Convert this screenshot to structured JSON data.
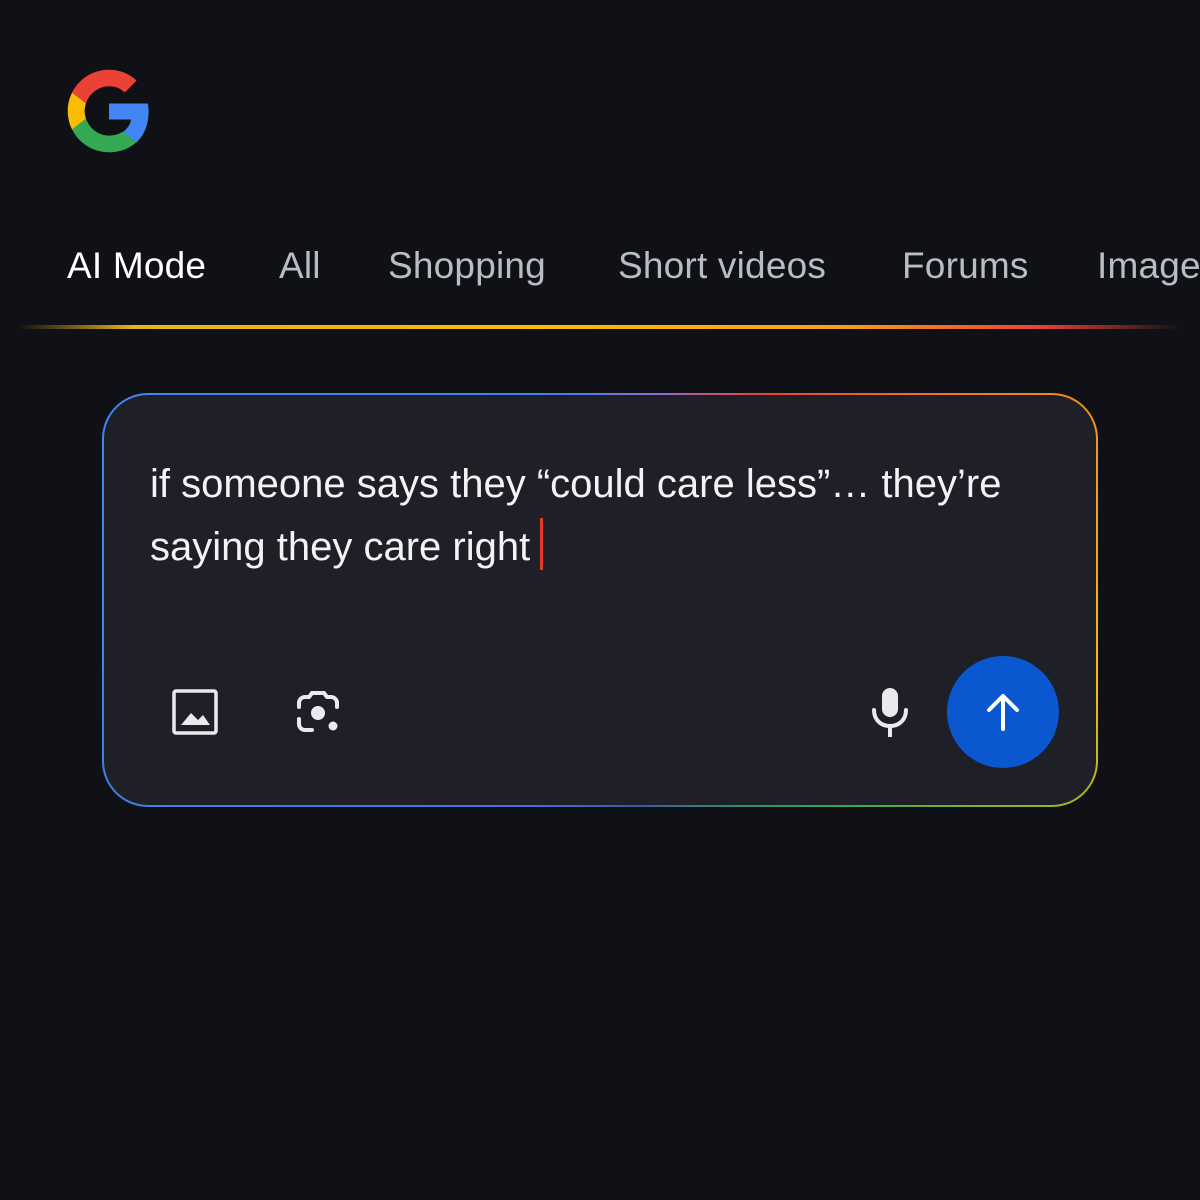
{
  "app": {
    "logo_icon": "google-g-icon"
  },
  "tabs": [
    {
      "label": "AI Mode",
      "active": true
    },
    {
      "label": "All",
      "active": false
    },
    {
      "label": "Shopping",
      "active": false
    },
    {
      "label": "Short videos",
      "active": false
    },
    {
      "label": "Forums",
      "active": false
    },
    {
      "label": "Images",
      "active": false
    }
  ],
  "search": {
    "query": "if someone says they “could care less”… they’re saying they care right",
    "tools": {
      "image_upload_icon": "image-icon",
      "lens_icon": "lens-camera-icon",
      "mic_icon": "microphone-icon",
      "send_icon": "arrow-up-icon"
    }
  },
  "colors": {
    "background": "#101116",
    "search_box": "#1e1f27",
    "send_button": "#0b57d0",
    "caret": "#e5392c",
    "tab_active": "#ffffff",
    "tab_inactive": "#b9bcc2"
  }
}
